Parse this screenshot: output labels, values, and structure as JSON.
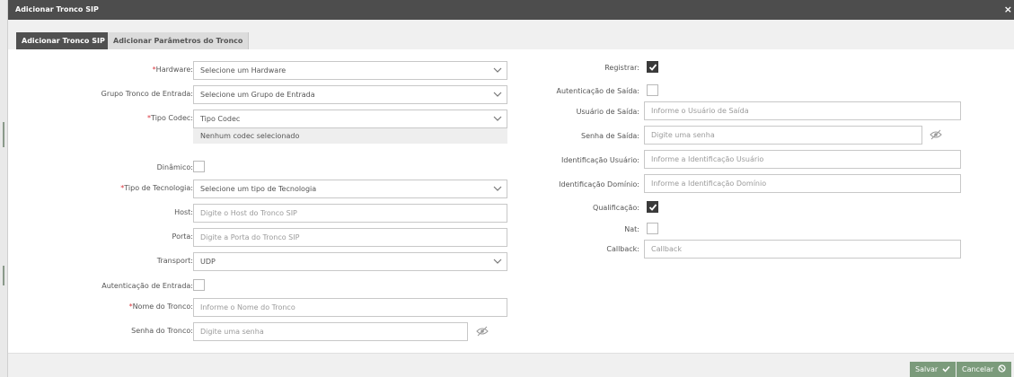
{
  "window": {
    "title": "Adicionar Tronco SIP",
    "close": "×"
  },
  "tabs": [
    {
      "label": "Adicionar Tronco SIP",
      "active": true
    },
    {
      "label": "Adicionar Parâmetros do Tronco",
      "active": false
    }
  ],
  "left": {
    "hardware": {
      "label": "Hardware:",
      "required": true,
      "value": "Selecione um Hardware"
    },
    "grupo": {
      "label": "Grupo Tronco de Entrada:",
      "value": "Selecione um Grupo de Entrada"
    },
    "codec": {
      "label": "Tipo Codec:",
      "required": true,
      "value": "Tipo Codec",
      "note": "Nenhum codec selecionado"
    },
    "dinamico": {
      "label": "Dinâmico:",
      "checked": false
    },
    "tecnologia": {
      "label": "Tipo de Tecnologia:",
      "required": true,
      "value": "Selecione um tipo de Tecnologia"
    },
    "host": {
      "label": "Host:",
      "placeholder": "Digite o Host do Tronco SIP"
    },
    "porta": {
      "label": "Porta:",
      "placeholder": "Digite a Porta do Tronco SIP"
    },
    "transport": {
      "label": "Transport:",
      "value": "UDP"
    },
    "aut_entrada": {
      "label": "Autenticação de Entrada:",
      "checked": false
    },
    "nome": {
      "label": "Nome do Tronco:",
      "required": true,
      "placeholder": "Informe o Nome do Tronco"
    },
    "senha": {
      "label": "Senha do Tronco:",
      "placeholder": "Digite uma senha"
    }
  },
  "right": {
    "registrar": {
      "label": "Registrar:",
      "checked": true
    },
    "aut_saida": {
      "label": "Autenticação de Saída:",
      "checked": false
    },
    "usuario_saida": {
      "label": "Usuário de Saída:",
      "placeholder": "Informe o Usuário de Saída"
    },
    "senha_saida": {
      "label": "Senha de Saída:",
      "placeholder": "Digite uma senha"
    },
    "ident_usuario": {
      "label": "Identificação Usuário:",
      "placeholder": "Informe a Identificação Usuário"
    },
    "ident_dominio": {
      "label": "Identificação Domínio:",
      "placeholder": "Informe a Identificação Domínio"
    },
    "qualificacao": {
      "label": "Qualificação:",
      "checked": true
    },
    "nat": {
      "label": "Nat:",
      "checked": false
    },
    "callback": {
      "label": "Callback:",
      "placeholder": "Callback"
    }
  },
  "footer": {
    "save": "Salvar",
    "cancel": "Cancelar"
  },
  "colors": {
    "titlebar": "#4d4d4d",
    "required": "#d9363e",
    "button": "#7b9b7b",
    "check_on": "#3a3a3a"
  },
  "icons": {
    "select": "chevron-down-icon",
    "password": "eye-slash-icon",
    "save": "check-icon",
    "cancel": "ban-icon",
    "window_close": "close-icon"
  }
}
